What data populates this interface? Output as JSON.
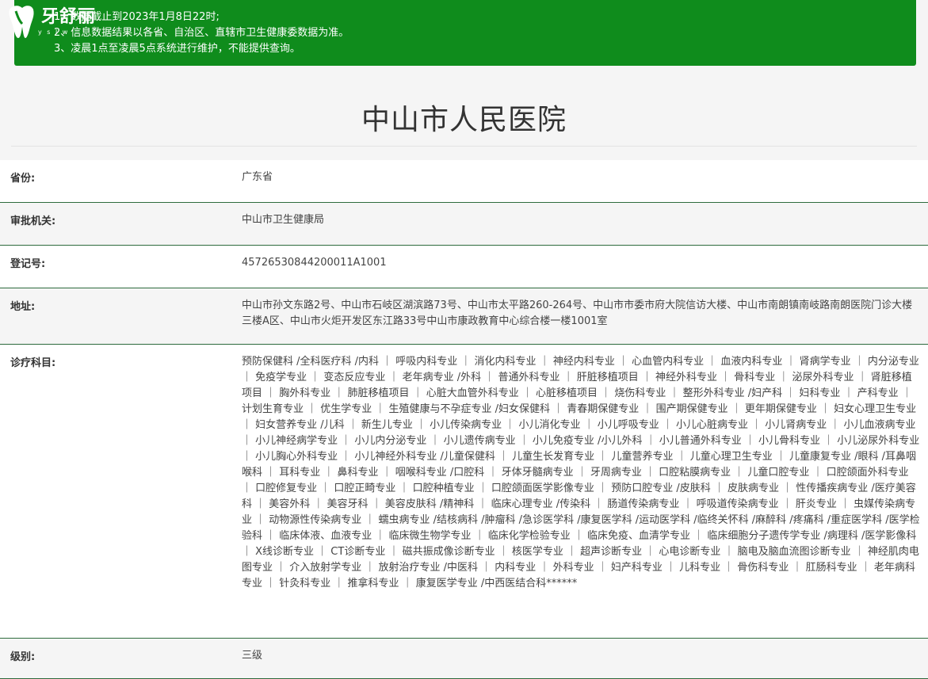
{
  "brand": {
    "logo_text": "牙舒丽",
    "logo_sub": "y s l w"
  },
  "notice": {
    "lines": [
      "1、数据截止到2023年1月8日22时;",
      "2、信息数据结果以各省、自治区、直辖市卫生健康委数据为准。",
      "3、凌晨1点至凌晨5点系统进行维护，不能提供查询。"
    ]
  },
  "hospital": {
    "name": "中山市人民医院"
  },
  "fields": {
    "province": {
      "label": "省份:",
      "value": "广东省"
    },
    "authority": {
      "label": "审批机关:",
      "value": "中山市卫生健康局"
    },
    "registration": {
      "label": "登记号:",
      "value": "45726530844200011A1001"
    },
    "address": {
      "label": "地址:",
      "value": "中山市孙文东路2号、中山市石岐区湖滨路73号、中山市太平路260-264号、中山市市委市府大院信访大楼、中山市南朗镇南岐路南朗医院门诊大楼三楼A区、中山市火炬开发区东江路33号中山市康政教育中心综合楼一楼1001室"
    },
    "departments": {
      "label": "诊疗科目:",
      "value": "预防保健科 /全科医疗科 /内科 ｜ 呼吸内科专业 ｜ 消化内科专业 ｜ 神经内科专业 ｜ 心血管内科专业 ｜ 血液内科专业 ｜ 肾病学专业 ｜ 内分泌专业 ｜ 免疫学专业 ｜ 变态反应专业 ｜ 老年病专业 /外科 ｜ 普通外科专业 ｜ 肝脏移植项目 ｜ 神经外科专业 ｜ 骨科专业 ｜ 泌尿外科专业 ｜ 肾脏移植项目 ｜ 胸外科专业 ｜ 肺脏移植项目 ｜ 心脏大血管外科专业 ｜ 心脏移植项目 ｜ 烧伤科专业 ｜ 整形外科专业 /妇产科 ｜ 妇科专业 ｜ 产科专业 ｜ 计划生育专业 ｜ 优生学专业 ｜ 生殖健康与不孕症专业 /妇女保健科 ｜ 青春期保健专业 ｜ 围产期保健专业 ｜ 更年期保健专业 ｜ 妇女心理卫生专业 ｜ 妇女营养专业 /儿科 ｜ 新生儿专业 ｜ 小儿传染病专业 ｜ 小儿消化专业 ｜ 小儿呼吸专业 ｜ 小儿心脏病专业 ｜ 小儿肾病专业 ｜ 小儿血液病专业 ｜ 小儿神经病学专业 ｜ 小儿内分泌专业 ｜ 小儿遗传病专业 ｜ 小儿免疫专业 /小儿外科 ｜ 小儿普通外科专业 ｜ 小儿骨科专业 ｜ 小儿泌尿外科专业 ｜ 小儿胸心外科专业 ｜ 小儿神经外科专业 /儿童保健科 ｜ 儿童生长发育专业 ｜ 儿童营养专业 ｜ 儿童心理卫生专业 ｜ 儿童康复专业 /眼科 /耳鼻咽喉科 ｜ 耳科专业 ｜ 鼻科专业 ｜ 咽喉科专业 /口腔科 ｜ 牙体牙髓病专业 ｜ 牙周病专业 ｜ 口腔粘膜病专业 ｜ 儿童口腔专业 ｜ 口腔颌面外科专业 ｜ 口腔修复专业 ｜ 口腔正畸专业 ｜ 口腔种植专业 ｜ 口腔颌面医学影像专业 ｜ 预防口腔专业 /皮肤科 ｜ 皮肤病专业 ｜ 性传播疾病专业 /医疗美容科 ｜ 美容外科 ｜ 美容牙科 ｜ 美容皮肤科 /精神科 ｜ 临床心理专业 /传染科 ｜ 肠道传染病专业 ｜ 呼吸道传染病专业 ｜ 肝炎专业 ｜ 虫媒传染病专业 ｜ 动物源性传染病专业 ｜ 蠕虫病专业 /结核病科 /肿瘤科 /急诊医学科 /康复医学科 /运动医学科 /临终关怀科 /麻醉科 /疼痛科 /重症医学科 /医学检验科 ｜ 临床体液、血液专业 ｜ 临床微生物学专业 ｜ 临床化学检验专业 ｜ 临床免疫、血清学专业 ｜ 临床细胞分子遗传学专业 /病理科 /医学影像科 ｜ X线诊断专业 ｜ CT诊断专业 ｜ 磁共振成像诊断专业 ｜ 核医学专业 ｜ 超声诊断专业 ｜ 心电诊断专业 ｜ 脑电及脑血流图诊断专业 ｜ 神经肌肉电图专业 ｜ 介入放射学专业 ｜ 放射治疗专业 /中医科 ｜ 内科专业 ｜ 外科专业 ｜ 妇产科专业 ｜ 儿科专业 ｜ 骨伤科专业 ｜ 肛肠科专业 ｜ 老年病科专业 ｜ 针灸科专业 ｜ 推拿科专业 ｜ 康复医学专业 /中西医结合科******"
    },
    "level": {
      "label": "级别:",
      "value": "三级"
    }
  },
  "colors": {
    "notice_bg": "#0f8c1c",
    "row_border": "#2e6b3d",
    "page_bg": "#f5f5f5"
  }
}
